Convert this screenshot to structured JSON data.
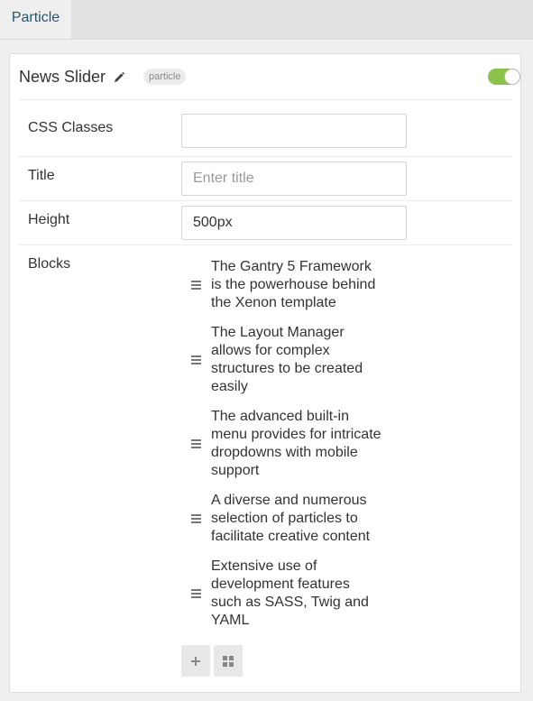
{
  "tabs": [
    {
      "label": "Particle",
      "active": true
    }
  ],
  "card": {
    "title": "News Slider",
    "badge": "particle",
    "enabled": true,
    "toggle_color": "#8bc34a"
  },
  "fields": {
    "css_classes": {
      "label": "CSS Classes",
      "value": "",
      "placeholder": ""
    },
    "title": {
      "label": "Title",
      "value": "",
      "placeholder": "Enter title"
    },
    "height": {
      "label": "Height",
      "value": "500px",
      "placeholder": ""
    },
    "blocks": {
      "label": "Blocks"
    }
  },
  "blocks": [
    {
      "text": "The Gantry 5 Framework is the powerhouse behind the Xenon template"
    },
    {
      "text": "The Layout Manager allows for complex structures to be created easily"
    },
    {
      "text": "The advanced built-in menu provides for intricate dropdowns with mobile support"
    },
    {
      "text": "A diverse and numerous selection of particles to facilitate creative content"
    },
    {
      "text": "Extensive use of development features such as SASS, Twig and YAML"
    }
  ],
  "actions": {
    "add_icon": "plus-icon",
    "grid_icon": "grid-icon"
  }
}
